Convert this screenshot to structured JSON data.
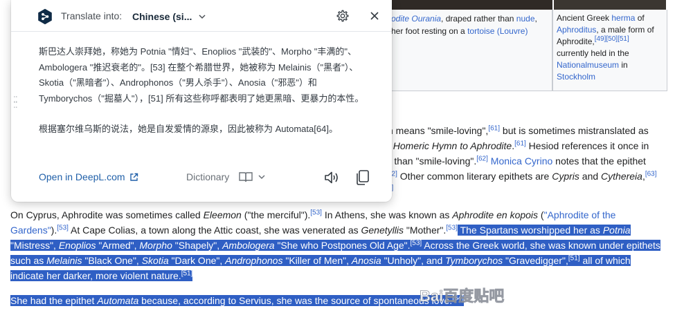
{
  "captions": {
    "left": {
      "part1_link": "odite Ourania",
      "part2": ", draped rather than ",
      "part3_link": "nude",
      "part4": ",",
      "line2_part1": "her foot resting on a ",
      "line2_link": "tortoise (Louvre)"
    },
    "right": {
      "line1": "Ancient Greek ",
      "line1_link": "herma",
      "line1_end": " of",
      "line2_link": "Aphroditus",
      "line2_end": ", a male form of",
      "line3": "Aphrodite,",
      "line3_refs": "[49][50][51]",
      "line4": "currently held in the",
      "line5_link": "Nationalmuseum",
      "line5_end": " in",
      "line6_link": "Stockholm"
    }
  },
  "article": {
    "p1": {
      "l1_a": "ch means \"smile-loving\",",
      "l1_ref": "[61]",
      "l1_b": " but is sometimes mistranslated as",
      "l2_a": "st Homeric Hymn to Aphrodite",
      "l2_b": ".",
      "l2_ref": "[61]",
      "l2_c": " Hesiod references it once in",
      "l3_a": "er than \"smile-loving\".",
      "l3_ref": "[62]",
      "l3_link": " Monica Cyrino",
      "l3_b": " notes that the epithet",
      "l4_ref": "62]",
      "l4_a": " Other common literary epithets are ",
      "l4_i1": "Cypris",
      "l4_b": " and ",
      "l4_i2": "Cythereia",
      "l4_c": ",",
      "l4_ref2": "[63]",
      "l5_ref": "3]"
    },
    "p2": {
      "l1_a": "On Cyprus, Aphrodite was sometimes called ",
      "l1_i": "Eleemon",
      "l1_b": " (\"the merciful\").",
      "l1_ref": "[53]",
      "l1_c": " In Athens, she was known as ",
      "l1_i2": "Aphrodite en kopois",
      "l1_d": " (",
      "l1_link": "\"Aphrodite of the",
      "l2_link": "Gardens\"",
      "l2_a": ").",
      "l2_ref": "[53]",
      "l2_b": " At Cape Colias, a town along the Attic coast, she was venerated as ",
      "l2_i": "Genetyllis",
      "l2_c": " \"Mother\".",
      "l2_ref2": "[53]",
      "l2_hl_a": " The Spartans worshipped her as ",
      "l2_hl_i": "Potnia",
      "l3_a": "\"Mistress\", ",
      "l3_i1": "Enoplios",
      "l3_b": " \"Armed\", ",
      "l3_i2": "Morpho",
      "l3_c": " \"Shapely\", ",
      "l3_i3": "Ambologera",
      "l3_d": " \"She who Postpones Old Age\".",
      "l3_ref": "[53]",
      "l3_e": " Across the Greek world, she was known under epithets",
      "l4_a": "such as ",
      "l4_i1": "Melainis",
      "l4_b": " \"Black One\", ",
      "l4_i2": "Skotia",
      "l4_c": " \"Dark One\", ",
      "l4_i3": "Androphonos",
      "l4_d": " \"Killer of Men\", ",
      "l4_i4": "Anosia",
      "l4_e": " \"Unholy\", and ",
      "l4_i5": "Tymborychos",
      "l4_f": " \"Gravedigger\",",
      "l4_ref": "[51]",
      "l4_g": " all of which",
      "l5_a": "indicate her darker, more violent nature.",
      "l5_ref": "[51]"
    },
    "p3": {
      "a": "She had the epithet ",
      "i": "Automata",
      "b": " because, according to Servius, she was the source of spontaneous love.",
      "ref": "[64]"
    }
  },
  "watermark": {
    "text": "Bai百度贴吧"
  },
  "popup": {
    "translate_label": "Translate into:",
    "target_language": "Chinese (si...",
    "translation_p1": "斯巴达人崇拜她，称她为 Potnia \"情妇\"、Enoplios \"武装的\"、Morpho \"丰满的\"、Ambologera \"推迟衰老的\"。[53] 在整个希腊世界，她被称为 Melainis（\"黑者\"）、Skotia（\"黑暗者\"）、Androphonos（\"男人杀手\"）、Anosia（\"邪恶\"）和 Tymborychos（\"掘墓人\"），[51] 所有这些称呼都表明了她更黑暗、更暴力的本性。",
    "translation_p2": "根据塞尔维乌斯的说法，她是自发爱情的源泉，因此被称为 Automata[64]。",
    "open_link": "Open in DeepL.com",
    "dictionary": "Dictionary"
  },
  "icons": {
    "logo": "deepl-logo-icon",
    "chevron": "chevron-down-icon",
    "settings": "gear-icon",
    "close": "close-icon",
    "external": "external-link-icon",
    "book": "book-icon",
    "speaker": "speaker-icon",
    "copy": "copy-icon",
    "drag": "drag-handle-icon"
  },
  "colors": {
    "link": "#3366cc",
    "highlight": "#2f5fc4",
    "deepl_navy": "#0f2b46",
    "deepl_link": "#1f5fa8"
  }
}
